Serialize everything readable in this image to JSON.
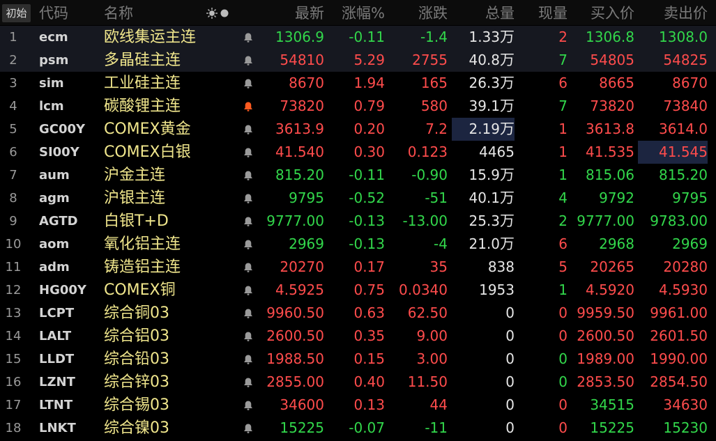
{
  "header": {
    "init_button": "初始",
    "columns": {
      "code": "代码",
      "name": "名称",
      "latest": "最新",
      "pct": "涨幅%",
      "chg": "涨跌",
      "volume": "总量",
      "current": "现量",
      "bid": "买入价",
      "ask": "卖出价"
    },
    "icons": [
      "sun-icon",
      "circle-icon"
    ]
  },
  "colors": {
    "up": "#ff4c4c",
    "down": "#32d74b",
    "neutral": "#e6e6e6",
    "name": "#f0e68c",
    "alert": "#ff5a1f"
  },
  "rows": [
    {
      "idx": "1",
      "code": "ecm",
      "name": "欧线集运主连",
      "bell": "bell-icon",
      "latest": "1306.9",
      "pct": "-0.11",
      "chg": "-1.4",
      "vol": "1.33",
      "vol_unit": "万",
      "cur": "2",
      "bid": "1306.8",
      "ask": "1308.0",
      "c_latest": "green",
      "c_pct": "green",
      "c_chg": "green",
      "c_cur": "red",
      "c_bid": "green",
      "c_ask": "green",
      "selected": true
    },
    {
      "idx": "2",
      "code": "psm",
      "name": "多晶硅主连",
      "bell": "bell-icon",
      "latest": "54810",
      "pct": "5.29",
      "chg": "2755",
      "vol": "40.8",
      "vol_unit": "万",
      "cur": "7",
      "bid": "54805",
      "ask": "54825",
      "c_latest": "red",
      "c_pct": "red",
      "c_chg": "red",
      "c_cur": "green",
      "c_bid": "red",
      "c_ask": "red",
      "selected": true
    },
    {
      "idx": "3",
      "code": "sim",
      "name": "工业硅主连",
      "bell": "bell-icon",
      "latest": "8670",
      "pct": "1.94",
      "chg": "165",
      "vol": "26.3",
      "vol_unit": "万",
      "cur": "6",
      "bid": "8665",
      "ask": "8670",
      "c_latest": "red",
      "c_pct": "red",
      "c_chg": "red",
      "c_cur": "red",
      "c_bid": "red",
      "c_ask": "red"
    },
    {
      "idx": "4",
      "code": "lcm",
      "name": "碳酸锂主连",
      "bell": "bell-alert-icon",
      "latest": "73820",
      "pct": "0.79",
      "chg": "580",
      "vol": "39.1",
      "vol_unit": "万",
      "cur": "7",
      "bid": "73820",
      "ask": "73840",
      "c_latest": "red",
      "c_pct": "red",
      "c_chg": "red",
      "c_cur": "green",
      "c_bid": "red",
      "c_ask": "red"
    },
    {
      "idx": "5",
      "code": "GC00Y",
      "name": "COMEX黄金",
      "bell": "bell-icon",
      "latest": "3613.9",
      "pct": "0.20",
      "chg": "7.2",
      "vol": "2.19",
      "vol_unit": "万",
      "cur": "1",
      "bid": "3613.8",
      "ask": "3614.0",
      "c_latest": "red",
      "c_pct": "red",
      "c_chg": "red",
      "c_cur": "red",
      "c_bid": "red",
      "c_ask": "red",
      "hl_vol": true
    },
    {
      "idx": "6",
      "code": "SI00Y",
      "name": "COMEX白银",
      "bell": "bell-icon",
      "latest": "41.540",
      "pct": "0.30",
      "chg": "0.123",
      "vol": "4465",
      "vol_unit": "",
      "cur": "1",
      "bid": "41.535",
      "ask": "41.545",
      "c_latest": "red",
      "c_pct": "red",
      "c_chg": "red",
      "c_cur": "red",
      "c_bid": "red",
      "c_ask": "red",
      "hl_ask": true
    },
    {
      "idx": "7",
      "code": "aum",
      "name": "沪金主连",
      "bell": "bell-icon",
      "latest": "815.20",
      "pct": "-0.11",
      "chg": "-0.90",
      "vol": "15.9",
      "vol_unit": "万",
      "cur": "1",
      "bid": "815.06",
      "ask": "815.20",
      "c_latest": "green",
      "c_pct": "green",
      "c_chg": "green",
      "c_cur": "green",
      "c_bid": "green",
      "c_ask": "green"
    },
    {
      "idx": "8",
      "code": "agm",
      "name": "沪银主连",
      "bell": "bell-icon",
      "latest": "9795",
      "pct": "-0.52",
      "chg": "-51",
      "vol": "40.1",
      "vol_unit": "万",
      "cur": "4",
      "bid": "9792",
      "ask": "9795",
      "c_latest": "green",
      "c_pct": "green",
      "c_chg": "green",
      "c_cur": "green",
      "c_bid": "green",
      "c_ask": "green"
    },
    {
      "idx": "9",
      "code": "AGTD",
      "name": "白银T+D",
      "bell": "bell-icon",
      "latest": "9777.00",
      "pct": "-0.13",
      "chg": "-13.00",
      "vol": "25.3",
      "vol_unit": "万",
      "cur": "2",
      "bid": "9777.00",
      "ask": "9783.00",
      "c_latest": "green",
      "c_pct": "green",
      "c_chg": "green",
      "c_cur": "green",
      "c_bid": "green",
      "c_ask": "green"
    },
    {
      "idx": "10",
      "code": "aom",
      "name": "氧化铝主连",
      "bell": "bell-icon",
      "latest": "2969",
      "pct": "-0.13",
      "chg": "-4",
      "vol": "21.0",
      "vol_unit": "万",
      "cur": "6",
      "bid": "2968",
      "ask": "2969",
      "c_latest": "green",
      "c_pct": "green",
      "c_chg": "green",
      "c_cur": "red",
      "c_bid": "green",
      "c_ask": "green"
    },
    {
      "idx": "11",
      "code": "adm",
      "name": "铸造铝主连",
      "bell": "bell-icon",
      "latest": "20270",
      "pct": "0.17",
      "chg": "35",
      "vol": "838",
      "vol_unit": "",
      "cur": "5",
      "bid": "20265",
      "ask": "20280",
      "c_latest": "red",
      "c_pct": "red",
      "c_chg": "red",
      "c_cur": "red",
      "c_bid": "red",
      "c_ask": "red"
    },
    {
      "idx": "12",
      "code": "HG00Y",
      "name": "COMEX铜",
      "bell": "bell-icon",
      "latest": "4.5925",
      "pct": "0.75",
      "chg": "0.0340",
      "vol": "1953",
      "vol_unit": "",
      "cur": "1",
      "bid": "4.5920",
      "ask": "4.5930",
      "c_latest": "red",
      "c_pct": "red",
      "c_chg": "red",
      "c_cur": "green",
      "c_bid": "red",
      "c_ask": "red"
    },
    {
      "idx": "13",
      "code": "LCPT",
      "name": "综合铜03",
      "bell": "bell-icon",
      "latest": "9960.50",
      "pct": "0.63",
      "chg": "62.50",
      "vol": "0",
      "vol_unit": "",
      "cur": "0",
      "bid": "9959.50",
      "ask": "9961.00",
      "c_latest": "red",
      "c_pct": "red",
      "c_chg": "red",
      "c_cur": "red",
      "c_bid": "red",
      "c_ask": "red"
    },
    {
      "idx": "14",
      "code": "LALT",
      "name": "综合铝03",
      "bell": "bell-icon",
      "latest": "2600.50",
      "pct": "0.35",
      "chg": "9.00",
      "vol": "0",
      "vol_unit": "",
      "cur": "0",
      "bid": "2600.50",
      "ask": "2601.50",
      "c_latest": "red",
      "c_pct": "red",
      "c_chg": "red",
      "c_cur": "red",
      "c_bid": "red",
      "c_ask": "red"
    },
    {
      "idx": "15",
      "code": "LLDT",
      "name": "综合铅03",
      "bell": "bell-icon",
      "latest": "1988.50",
      "pct": "0.15",
      "chg": "3.00",
      "vol": "0",
      "vol_unit": "",
      "cur": "0",
      "bid": "1989.00",
      "ask": "1990.00",
      "c_latest": "red",
      "c_pct": "red",
      "c_chg": "red",
      "c_cur": "green",
      "c_bid": "red",
      "c_ask": "red"
    },
    {
      "idx": "16",
      "code": "LZNT",
      "name": "综合锌03",
      "bell": "bell-icon",
      "latest": "2855.00",
      "pct": "0.40",
      "chg": "11.50",
      "vol": "0",
      "vol_unit": "",
      "cur": "0",
      "bid": "2853.50",
      "ask": "2854.50",
      "c_latest": "red",
      "c_pct": "red",
      "c_chg": "red",
      "c_cur": "green",
      "c_bid": "red",
      "c_ask": "red"
    },
    {
      "idx": "17",
      "code": "LTNT",
      "name": "综合锡03",
      "bell": "bell-icon",
      "latest": "34600",
      "pct": "0.13",
      "chg": "44",
      "vol": "0",
      "vol_unit": "",
      "cur": "0",
      "bid": "34515",
      "ask": "34630",
      "c_latest": "red",
      "c_pct": "red",
      "c_chg": "red",
      "c_cur": "red",
      "c_bid": "green",
      "c_ask": "red"
    },
    {
      "idx": "18",
      "code": "LNKT",
      "name": "综合镍03",
      "bell": "bell-icon",
      "latest": "15225",
      "pct": "-0.07",
      "chg": "-11",
      "vol": "0",
      "vol_unit": "",
      "cur": "0",
      "bid": "15225",
      "ask": "15230",
      "c_latest": "green",
      "c_pct": "green",
      "c_chg": "green",
      "c_cur": "red",
      "c_bid": "green",
      "c_ask": "green"
    }
  ]
}
